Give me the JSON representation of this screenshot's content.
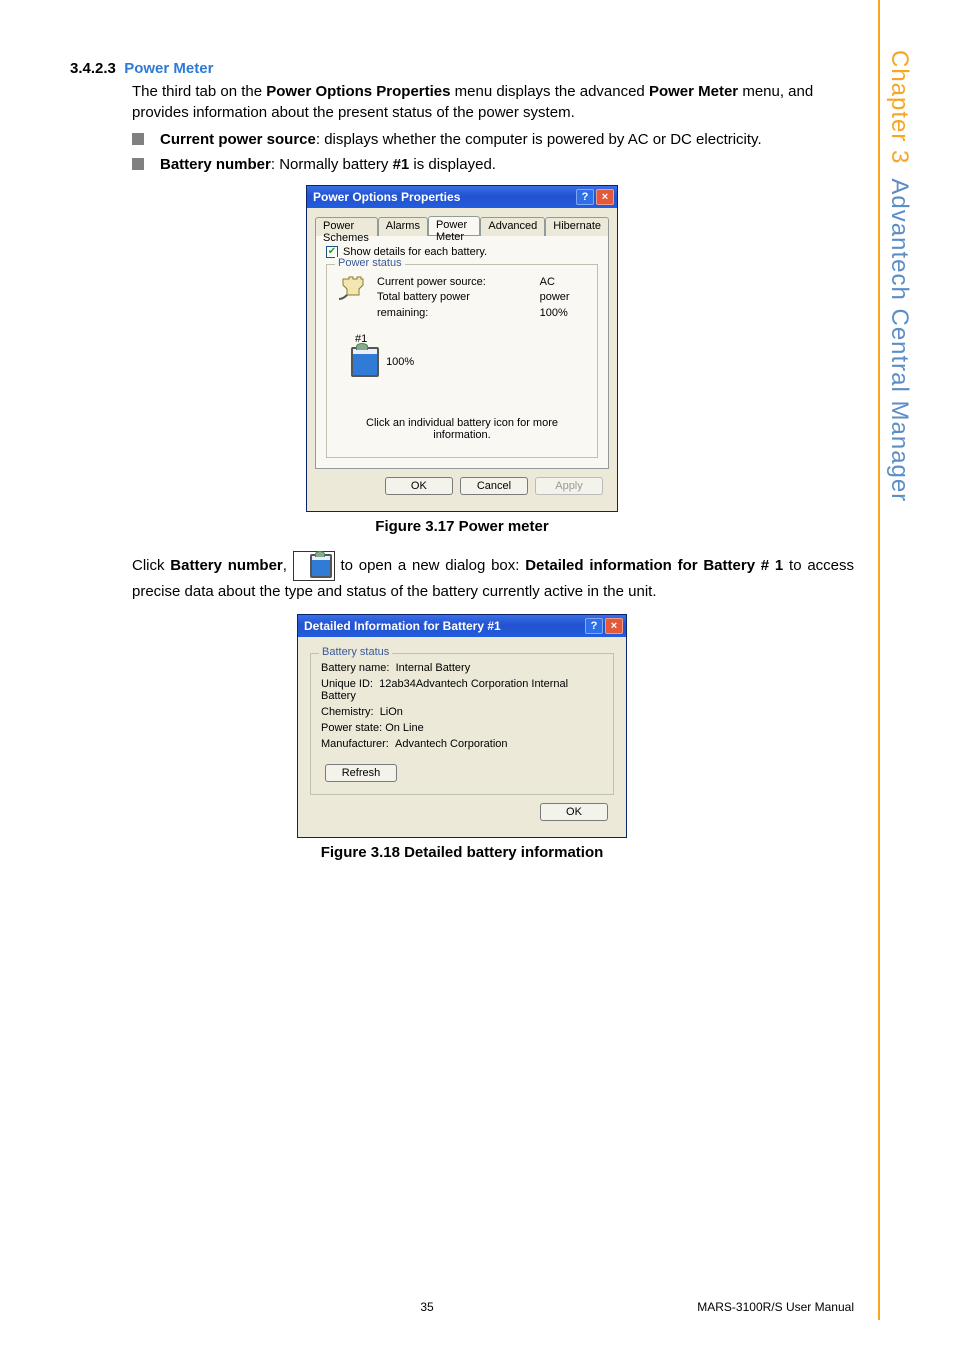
{
  "sidebar": {
    "chapter": "Chapter 3",
    "title": "Advantech Central Manager"
  },
  "section": {
    "number": "3.4.2.3",
    "title": "Power Meter",
    "p1_a": "The third tab on the ",
    "p1_b": "Power Options Properties",
    "p1_c": " menu displays the advanced ",
    "p1_d": "Power Meter",
    "p1_e": " menu, and provides information about the present status of the power system.",
    "bullets": [
      {
        "bold": "Current power source",
        "rest": ": displays whether the computer is powered by AC or DC electricity."
      },
      {
        "bold": "Battery number",
        "rest_a": ": Normally battery ",
        "rest_bold": "#1",
        "rest_b": " is displayed."
      }
    ]
  },
  "dialog1": {
    "title": "Power Options Properties",
    "tabs": [
      "Power Schemes",
      "Alarms",
      "Power Meter",
      "Advanced",
      "Hibernate"
    ],
    "active_tab_index": 2,
    "show_details": "Show details for each battery.",
    "fieldset_legend": "Power status",
    "cps_label": "Current power source:",
    "cps_value": "AC power",
    "tbpr_label": "Total battery power remaining:",
    "tbpr_value": "100%",
    "batt_num": "#1",
    "batt_pct": "100%",
    "hint": "Click an individual battery icon for more information.",
    "ok": "OK",
    "cancel": "Cancel",
    "apply": "Apply"
  },
  "fig1_caption": "Figure 3.17 Power meter",
  "para2": {
    "a": "Click ",
    "b": "Battery number",
    "c": ", ",
    "d": " to open a new dialog box: ",
    "e": "Detailed information for Battery # 1",
    "f": " to access precise data about the type and status of the battery currently active in the unit."
  },
  "dialog2": {
    "title": "Detailed Information for Battery #1",
    "legend": "Battery status",
    "rows": {
      "name_l": "Battery name:",
      "name_v": "Internal Battery",
      "uid_l": "Unique ID:",
      "uid_v": "12ab34Advantech Corporation Internal Battery",
      "chem_l": "Chemistry:",
      "chem_v": "LiOn",
      "state_l": "Power state:",
      "state_v": "On Line",
      "man_l": "Manufacturer:",
      "man_v": "Advantech Corporation"
    },
    "refresh": "Refresh",
    "ok": "OK"
  },
  "fig2_caption": "Figure 3.18 Detailed battery information",
  "footer": {
    "page": "35",
    "doc": "MARS-3100R/S User Manual"
  }
}
